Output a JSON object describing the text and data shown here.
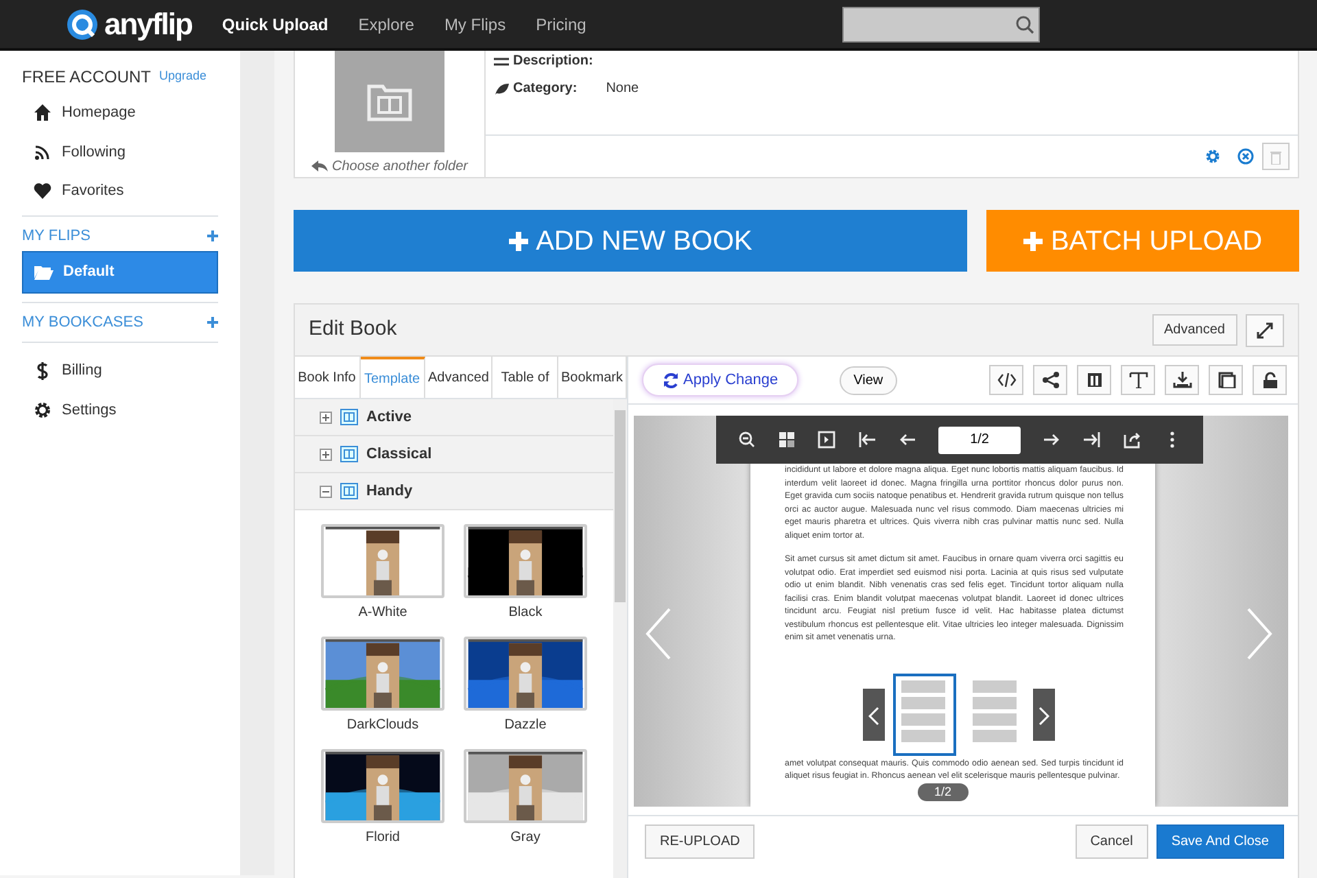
{
  "navbar": {
    "brand": "anyflip",
    "links": [
      {
        "label": "Quick Upload",
        "selected": true
      },
      {
        "label": "Explore",
        "selected": false
      },
      {
        "label": "My Flips",
        "selected": false
      },
      {
        "label": "Pricing",
        "selected": false
      }
    ]
  },
  "sidebar": {
    "account": "FREE ACCOUNT",
    "upgrade": "Upgrade",
    "items": [
      "Homepage",
      "Following",
      "Favorites"
    ],
    "flips_heading": "MY FLIPS",
    "folders": [
      {
        "label": "Default",
        "selected": true
      }
    ],
    "bookcases_heading": "MY BOOKCASES",
    "bottom_items": [
      "Billing",
      "Settings"
    ]
  },
  "book_card": {
    "description_label": "Description:",
    "category_label": "Category:",
    "category_value": "None",
    "folder_link": "Choose another folder"
  },
  "actions": {
    "add": "ADD NEW BOOK",
    "batch": "BATCH UPLOAD"
  },
  "editor": {
    "title": "Edit Book",
    "advanced": "Advanced",
    "tabs": [
      {
        "label": "Book Info",
        "selected": false
      },
      {
        "label": "Template",
        "selected": true
      },
      {
        "label": "Advanced",
        "selected": false
      },
      {
        "label": "Table of",
        "selected": false
      },
      {
        "label": "Bookmark",
        "selected": false
      }
    ],
    "template_groups": [
      {
        "label": "Active",
        "expanded": false
      },
      {
        "label": "Classical",
        "expanded": false
      },
      {
        "label": "Handy",
        "expanded": true
      }
    ],
    "templates": [
      "A-White",
      "Black",
      "DarkClouds",
      "Dazzle",
      "Florid",
      "Gray"
    ],
    "apply": "Apply Change",
    "view": "View",
    "page_input": "1/2",
    "page_paragraphs": [
      "incididunt ut labore et dolore magna aliqua. Eget nunc lobortis mattis aliquam faucibus. Id interdum velit laoreet id donec. Magna fringilla urna porttitor rhoncus dolor purus non. Eget gravida cum sociis natoque penatibus et. Hendrerit gravida rutrum quisque non tellus orci ac auctor augue. Malesuada nunc vel risus commodo. Diam maecenas ultricies mi eget mauris pharetra et ultrices. Quis viverra nibh cras pulvinar mattis nunc sed. Nulla aliquet enim tortor at.",
      "Sit amet cursus sit amet dictum sit amet. Faucibus in ornare quam viverra orci sagittis eu volutpat odio. Erat imperdiet sed euismod nisi porta. Lacinia at quis risus sed vulputate odio ut enim blandit. Nibh venenatis cras sed felis eget. Tincidunt tortor aliquam nulla facilisi cras. Enim blandit volutpat maecenas volutpat blandit. Laoreet id donec ultrices tincidunt arcu. Feugiat nisl pretium fusce id velit. Hac habitasse platea dictumst vestibulum rhoncus est pellentesque elit. Vitae ultricies leo integer malesuada. Dignissim enim sit amet venenatis urna.",
      "amet volutpat consequat mauris. Quis commodo odio aenean sed. Sed turpis tincidunt id aliquet risus feugiat in. Rhoncus aenean vel elit scelerisque mauris pellentesque pulvinar."
    ],
    "thumb_counter": "1/2",
    "reupload": "RE-UPLOAD",
    "cancel": "Cancel",
    "save": "Save And Close"
  }
}
